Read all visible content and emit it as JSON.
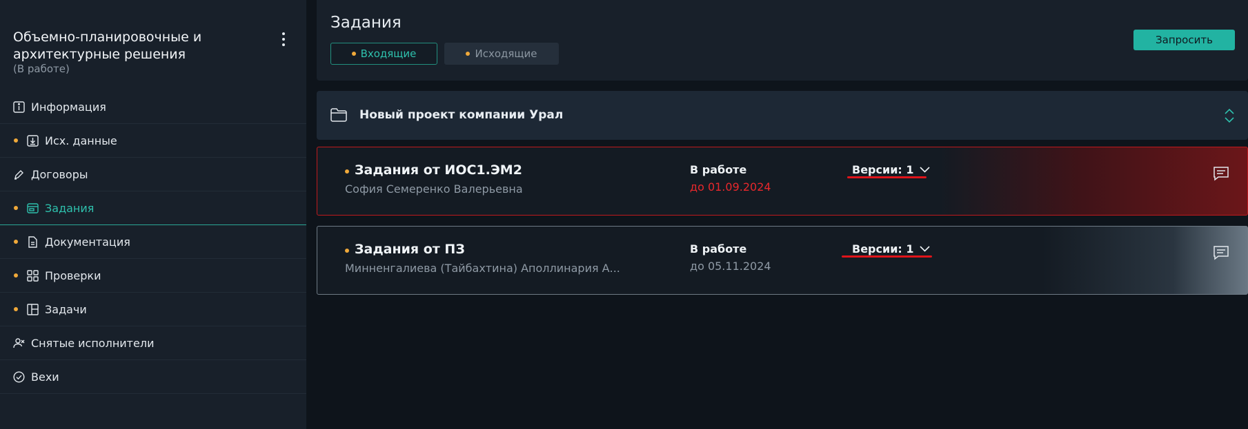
{
  "sidebar": {
    "project_title": "Объемно-планировочные и архитектурные решения",
    "project_status": "(В работе)",
    "menu_icon": "kebab-menu-icon",
    "items": [
      {
        "label": "Информация",
        "icon": "info-icon",
        "dot": false,
        "active": false
      },
      {
        "label": "Исх. данные",
        "icon": "download-icon",
        "dot": true,
        "active": false
      },
      {
        "label": "Договоры",
        "icon": "pen-icon",
        "dot": false,
        "active": false
      },
      {
        "label": "Задания",
        "icon": "window-icon",
        "dot": true,
        "active": true
      },
      {
        "label": "Документация",
        "icon": "document-icon",
        "dot": true,
        "active": false
      },
      {
        "label": "Проверки",
        "icon": "grid-icon",
        "dot": true,
        "active": false
      },
      {
        "label": "Задачи",
        "icon": "layout-icon",
        "dot": true,
        "active": false
      },
      {
        "label": "Снятые исполнители",
        "icon": "user-remove-icon",
        "dot": false,
        "active": false
      },
      {
        "label": "Вехи",
        "icon": "check-circle-icon",
        "dot": false,
        "active": false
      }
    ]
  },
  "header": {
    "title": "Задания",
    "tabs": [
      {
        "label": "Входящие",
        "active": true
      },
      {
        "label": "Исходящие",
        "active": false
      }
    ],
    "request_button": "Запросить"
  },
  "project": {
    "name": "Новый проект компании Урал",
    "icon": "folder-icon",
    "expand_icon": "expand-collapse-icon"
  },
  "tasks": [
    {
      "title": "Задания от ИОС1.ЭМ2",
      "person": "София Семеренко Валерьевна",
      "status": "В работе",
      "deadline": "до 01.09.2024",
      "versions": "Версии: 1",
      "overdue": true,
      "chat_icon": "comment-icon"
    },
    {
      "title": "Задания от ПЗ",
      "person": "Минненгалиева (Тайбахтина) Аполлинария А...",
      "status": "В работе",
      "deadline": "до 05.11.2024",
      "versions": "Версии: 1",
      "overdue": false,
      "chat_icon": "comment-icon"
    }
  ],
  "colors": {
    "accent": "#2ec1ad",
    "dot": "#f0a93a",
    "overdue": "#e8282c",
    "annotation": "#e0141a"
  }
}
